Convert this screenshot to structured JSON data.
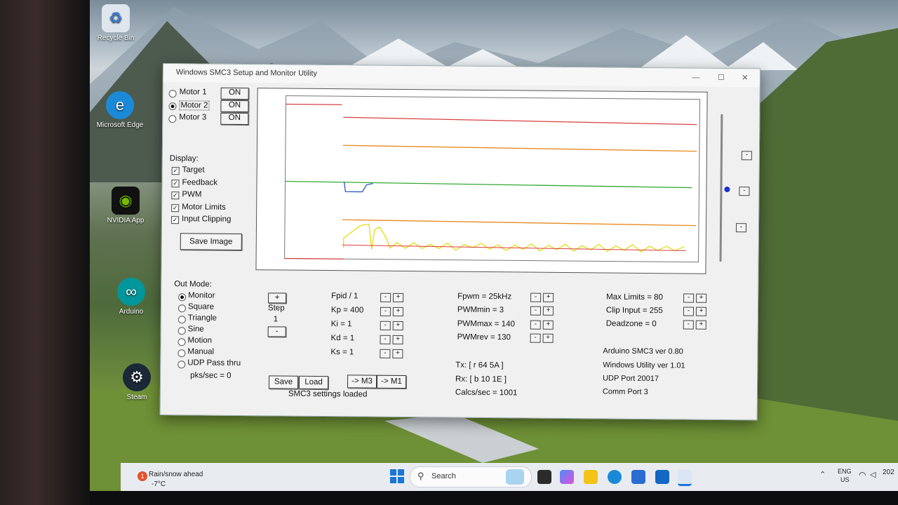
{
  "desktop_icons": [
    {
      "label": "Recycle Bin",
      "icon": "recycle-bin-icon"
    },
    {
      "label": "Microsoft Edge",
      "icon": "edge-icon"
    },
    {
      "label": "NVIDIA App",
      "icon": "nvidia-icon"
    },
    {
      "label": "Arduino",
      "icon": "arduino-icon"
    },
    {
      "label": "Steam",
      "icon": "steam-icon"
    }
  ],
  "window": {
    "title": "Windows SMC3 Setup and Monitor Utility",
    "motors": [
      {
        "label": "Motor 1",
        "state": "ON",
        "selected": false
      },
      {
        "label": "Motor 2",
        "state": "ON",
        "selected": true
      },
      {
        "label": "Motor 3",
        "state": "ON",
        "selected": false
      }
    ],
    "display": {
      "heading": "Display:",
      "items": [
        {
          "label": "Target",
          "checked": true
        },
        {
          "label": "Feedback",
          "checked": true
        },
        {
          "label": "PWM",
          "checked": true
        },
        {
          "label": "Motor Limits",
          "checked": true
        },
        {
          "label": "Input Clipping",
          "checked": true
        }
      ]
    },
    "save_image": "Save Image",
    "out_mode": {
      "heading": "Out Mode:",
      "options": [
        "Monitor",
        "Square",
        "Triangle",
        "Sine",
        "Motion",
        "Manual",
        "UDP Pass thru"
      ],
      "selected": "Monitor",
      "pks": "pks/sec = 0"
    },
    "step": {
      "plus": "+",
      "label": "Step",
      "value": "1",
      "minus": "-"
    },
    "pid": [
      "Fpid / 1",
      "Kp = 400",
      "Ki = 1",
      "Kd = 1",
      "Ks = 1"
    ],
    "pwm": [
      "Fpwm = 25kHz",
      "PWMmin = 3",
      "PWMmax = 140",
      "PWMrev = 130"
    ],
    "limits": [
      "Max Limits = 80",
      "Clip Input = 255",
      "Deadzone = 0"
    ],
    "minus": "-",
    "plus": "+",
    "buttons": {
      "save": "Save",
      "load": "Load",
      "to_m3": "-> M3",
      "to_m1": "-> M1"
    },
    "status": "SMC3 settings loaded",
    "tx": "Tx: [ r 64 5A ]",
    "rx": "Rx: [ b 10 1E ]",
    "calcs": "Calcs/sec = 1001",
    "info": [
      "Arduino SMC3 ver 0.80",
      "Windows Utility ver 1.01",
      "UDP Port 20017",
      "Comm Port 3"
    ]
  },
  "taskbar": {
    "weather": "Rain/snow ahead",
    "temp": "-7°C",
    "weather_badge": "1",
    "search_placeholder": "Search",
    "lang": "ENG",
    "region": "US",
    "clock": "202"
  },
  "colors": {
    "target": "#d84040",
    "limit": "#e88a20",
    "feedback": "#33aa33",
    "pwm": "#e8d800",
    "blue": "#2255cc"
  }
}
